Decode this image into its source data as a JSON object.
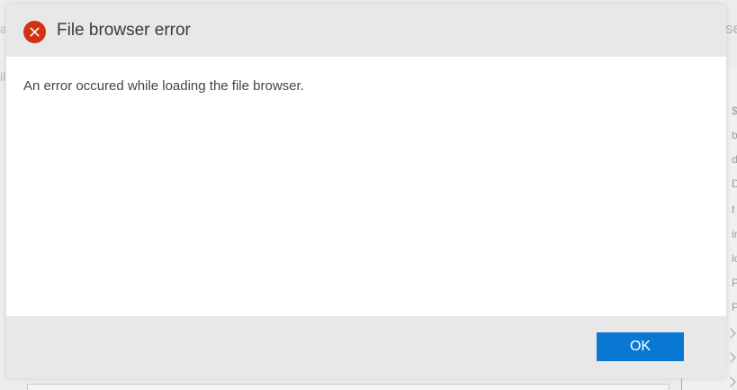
{
  "background": {
    "right_panel_fragments": [
      "$",
      "b",
      "d",
      "D",
      "f",
      "in",
      "lo",
      "P",
      "P"
    ],
    "left_fragments": [
      "a",
      "il"
    ],
    "top_right_fragment": "se"
  },
  "dialog": {
    "title": "File browser error",
    "message": "An error occured while loading the file browser.",
    "ok_label": "OK",
    "icon": "error-circle-x-icon",
    "colors": {
      "error_icon": "#d13212",
      "ok_button": "#0a78d2",
      "header_footer": "#e8e8e8",
      "body": "#ffffff"
    }
  }
}
